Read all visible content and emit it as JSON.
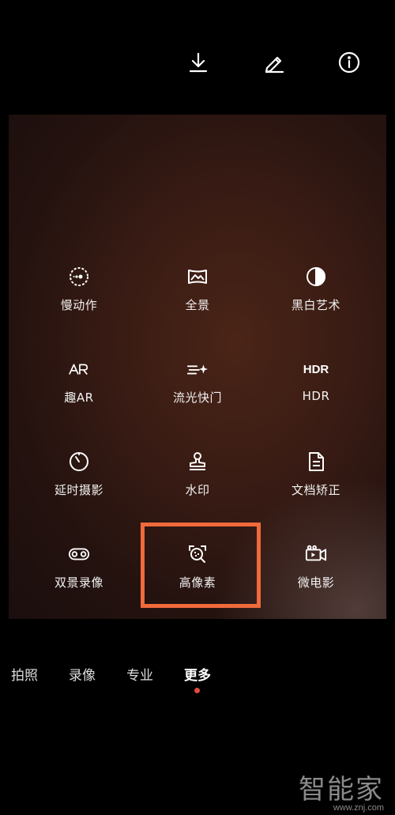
{
  "toolbar": {
    "icons": [
      "download-icon",
      "edit-pencil-icon",
      "info-icon"
    ]
  },
  "modes": [
    {
      "label": "慢动作",
      "icon": "slow-motion-icon"
    },
    {
      "label": "全景",
      "icon": "panorama-icon"
    },
    {
      "label": "黑白艺术",
      "icon": "monochrome-icon"
    },
    {
      "label": "趣AR",
      "icon": "ar-icon"
    },
    {
      "label": "流光快门",
      "icon": "light-painting-icon"
    },
    {
      "label": "HDR",
      "icon": "hdr-icon",
      "icon_text": "HDR"
    },
    {
      "label": "延时摄影",
      "icon": "time-lapse-icon"
    },
    {
      "label": "水印",
      "icon": "watermark-stamp-icon"
    },
    {
      "label": "文档矫正",
      "icon": "document-icon"
    },
    {
      "label": "双景录像",
      "icon": "dual-view-icon"
    },
    {
      "label": "高像素",
      "icon": "high-resolution-icon",
      "highlighted": true
    },
    {
      "label": "微电影",
      "icon": "micro-movie-icon"
    }
  ],
  "tabs": [
    {
      "label": "拍照"
    },
    {
      "label": "录像"
    },
    {
      "label": "专业"
    },
    {
      "label": "更多",
      "active": true
    }
  ],
  "watermark": {
    "brand": "智能家",
    "url": "www.znj.com"
  },
  "colors": {
    "highlight": "#f06a3c",
    "active_dot": "#e24a3b",
    "background": "#000000"
  }
}
